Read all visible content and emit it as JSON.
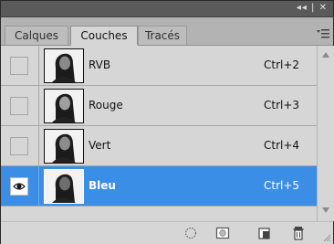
{
  "tabs": [
    {
      "label": "Calques",
      "active": false
    },
    {
      "label": "Couches",
      "active": true
    },
    {
      "label": "Tracés",
      "active": false
    }
  ],
  "title_controls": "◂◂ | ✕",
  "channels": [
    {
      "name": "RVB",
      "shortcut": "Ctrl+2",
      "visible": false,
      "selected": false
    },
    {
      "name": "Rouge",
      "shortcut": "Ctrl+3",
      "visible": false,
      "selected": false
    },
    {
      "name": "Vert",
      "shortcut": "Ctrl+4",
      "visible": false,
      "selected": false
    },
    {
      "name": "Bleu",
      "shortcut": "Ctrl+5",
      "visible": true,
      "selected": true
    }
  ],
  "bottom_icons": [
    "load-selection-icon",
    "save-selection-icon",
    "new-channel-icon",
    "trash-icon"
  ],
  "colors": {
    "selection": "#3a8ee6",
    "panel": "#d6d6d6",
    "titlebar": "#5a5a5a"
  }
}
